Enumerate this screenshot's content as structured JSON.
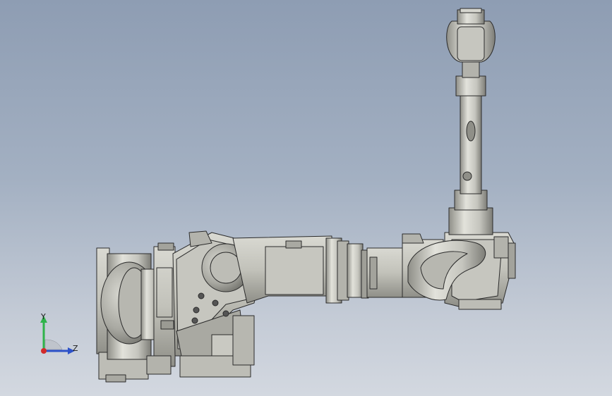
{
  "viewport": {
    "background_top": "#8e9db3",
    "background_bottom": "#d3d8e0"
  },
  "model": {
    "description_icon": "robot-arm-model",
    "part_color": "#c9c9c2",
    "edge_color": "#2b2b2b",
    "shade_color": "#9a9a93"
  },
  "triad": {
    "y_label": "Y",
    "z_label": "Z",
    "y_color": "#2fb34a",
    "z_color": "#2d52c8",
    "origin_color": "#d22a2a"
  }
}
